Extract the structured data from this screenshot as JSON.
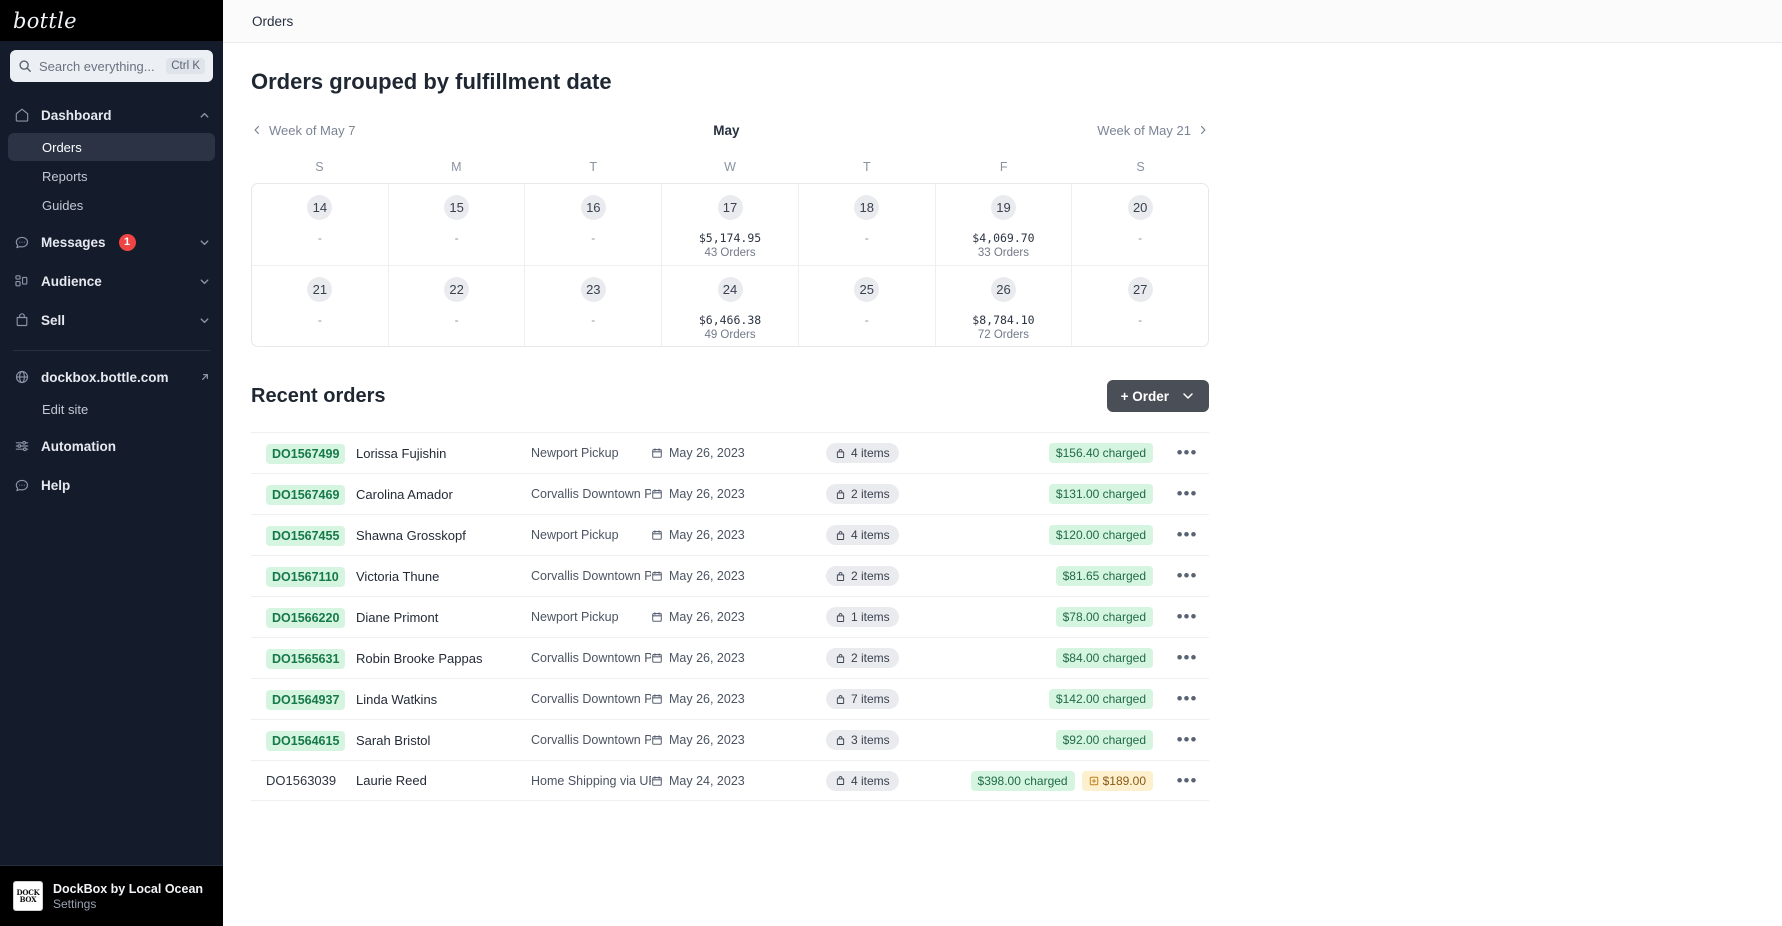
{
  "sidebar": {
    "brand": "bottle",
    "search": {
      "placeholder": "Search everything...",
      "shortcut": "Ctrl K",
      "icon": "search-icon"
    },
    "nav": [
      {
        "label": "Dashboard",
        "icon": "home-icon",
        "chevron": "chevron-up-icon",
        "expanded": true,
        "children": [
          {
            "label": "Orders",
            "active": true
          },
          {
            "label": "Reports",
            "active": false
          },
          {
            "label": "Guides",
            "active": false
          }
        ]
      },
      {
        "label": "Messages",
        "icon": "chat-icon",
        "chevron": "chevron-down-icon",
        "badge": "1"
      },
      {
        "label": "Audience",
        "icon": "audience-icon",
        "chevron": "chevron-down-icon"
      },
      {
        "label": "Sell",
        "icon": "bag-icon",
        "chevron": "chevron-down-icon"
      }
    ],
    "site": {
      "label": "dockbox.bottle.com",
      "icon": "globe-icon",
      "external": "external-link-icon",
      "edit_label": "Edit site"
    },
    "tools": [
      {
        "label": "Automation",
        "icon": "sliders-icon"
      },
      {
        "label": "Help",
        "icon": "help-chat-icon"
      }
    ],
    "account": {
      "logo_line1": "DOCK",
      "logo_line2": "BOX",
      "name": "DockBox by Local Ocean",
      "sub": "Settings"
    }
  },
  "topbar": {
    "title": "Orders"
  },
  "page": {
    "title": "Orders grouped by fulfillment date"
  },
  "calendar": {
    "prev_label": "Week of May 7",
    "next_label": "Week of May 21",
    "month": "May",
    "dow": [
      "S",
      "M",
      "T",
      "W",
      "T",
      "F",
      "S"
    ],
    "weeks": [
      [
        {
          "day": "14",
          "amount": "",
          "orders": "",
          "empty": "-"
        },
        {
          "day": "15",
          "amount": "",
          "orders": "",
          "empty": "-"
        },
        {
          "day": "16",
          "amount": "",
          "orders": "",
          "empty": "-"
        },
        {
          "day": "17",
          "amount": "$5,174.95",
          "orders": "43 Orders",
          "empty": ""
        },
        {
          "day": "18",
          "amount": "",
          "orders": "",
          "empty": "-"
        },
        {
          "day": "19",
          "amount": "$4,069.70",
          "orders": "33 Orders",
          "empty": ""
        },
        {
          "day": "20",
          "amount": "",
          "orders": "",
          "empty": "-"
        }
      ],
      [
        {
          "day": "21",
          "amount": "",
          "orders": "",
          "empty": "-"
        },
        {
          "day": "22",
          "amount": "",
          "orders": "",
          "empty": "-"
        },
        {
          "day": "23",
          "amount": "",
          "orders": "",
          "empty": "-"
        },
        {
          "day": "24",
          "amount": "$6,466.38",
          "orders": "49 Orders",
          "empty": ""
        },
        {
          "day": "25",
          "amount": "",
          "orders": "",
          "empty": "-"
        },
        {
          "day": "26",
          "amount": "$8,784.10",
          "orders": "72 Orders",
          "empty": ""
        },
        {
          "day": "27",
          "amount": "",
          "orders": "",
          "empty": "-"
        }
      ]
    ]
  },
  "recent": {
    "title": "Recent orders",
    "add_button": "+ Order",
    "rows": [
      {
        "id": "DO1567499",
        "id_pill": true,
        "name": "Lorissa Fujishin",
        "location": "Newport Pickup",
        "date": "May 26, 2023",
        "items": "4 items",
        "paid": "$156.40 charged",
        "due": ""
      },
      {
        "id": "DO1567469",
        "id_pill": true,
        "name": "Carolina Amador",
        "location": "Corvallis Downtown Pickup",
        "date": "May 26, 2023",
        "items": "2 items",
        "paid": "$131.00 charged",
        "due": ""
      },
      {
        "id": "DO1567455",
        "id_pill": true,
        "name": "Shawna Grosskopf",
        "location": "Newport Pickup",
        "date": "May 26, 2023",
        "items": "4 items",
        "paid": "$120.00 charged",
        "due": ""
      },
      {
        "id": "DO1567110",
        "id_pill": true,
        "name": "Victoria Thune",
        "location": "Corvallis Downtown Pickup",
        "date": "May 26, 2023",
        "items": "2 items",
        "paid": "$81.65 charged",
        "due": ""
      },
      {
        "id": "DO1566220",
        "id_pill": true,
        "name": "Diane Primont",
        "location": "Newport Pickup",
        "date": "May 26, 2023",
        "items": "1 items",
        "paid": "$78.00 charged",
        "due": ""
      },
      {
        "id": "DO1565631",
        "id_pill": true,
        "name": "Robin Brooke Pappas",
        "location": "Corvallis Downtown Pickup",
        "date": "May 26, 2023",
        "items": "2 items",
        "paid": "$84.00 charged",
        "due": ""
      },
      {
        "id": "DO1564937",
        "id_pill": true,
        "name": "Linda Watkins",
        "location": "Corvallis Downtown Pickup",
        "date": "May 26, 2023",
        "items": "7 items",
        "paid": "$142.00 charged",
        "due": ""
      },
      {
        "id": "DO1564615",
        "id_pill": true,
        "name": "Sarah Bristol",
        "location": "Corvallis Downtown Pickup",
        "date": "May 26, 2023",
        "items": "3 items",
        "paid": "$92.00 charged",
        "due": ""
      },
      {
        "id": "DO1563039",
        "id_pill": false,
        "name": "Laurie Reed",
        "location": "Home Shipping via UPS",
        "date": "May 24, 2023",
        "items": "4 items",
        "paid": "$398.00 charged",
        "due": "$189.00"
      }
    ]
  },
  "colors": {
    "sidebar_bg": "#141b2b",
    "brand_bar_bg": "#000000",
    "accent_green": "#d6f5e0",
    "accent_green_text": "#16794a",
    "badge_red": "#ef4444",
    "due_amber": "#fdf0cf",
    "order_btn": "#4a4f57"
  }
}
